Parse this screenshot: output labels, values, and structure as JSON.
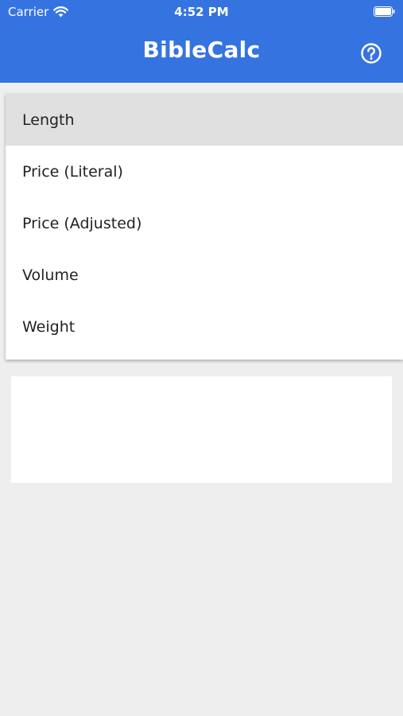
{
  "status_bar": {
    "carrier": "Carrier",
    "time": "4:52 PM",
    "wifi_icon": "wifi-icon",
    "battery_icon": "battery-icon"
  },
  "app_bar": {
    "title": "BibleCalc",
    "help_icon": "help-circle-icon",
    "color": "#3574e0"
  },
  "dropdown": {
    "items": [
      {
        "label": "Length",
        "selected": true
      },
      {
        "label": "Price (Literal)",
        "selected": false
      },
      {
        "label": "Price (Adjusted)",
        "selected": false
      },
      {
        "label": "Volume",
        "selected": false
      },
      {
        "label": "Weight",
        "selected": false
      }
    ]
  }
}
